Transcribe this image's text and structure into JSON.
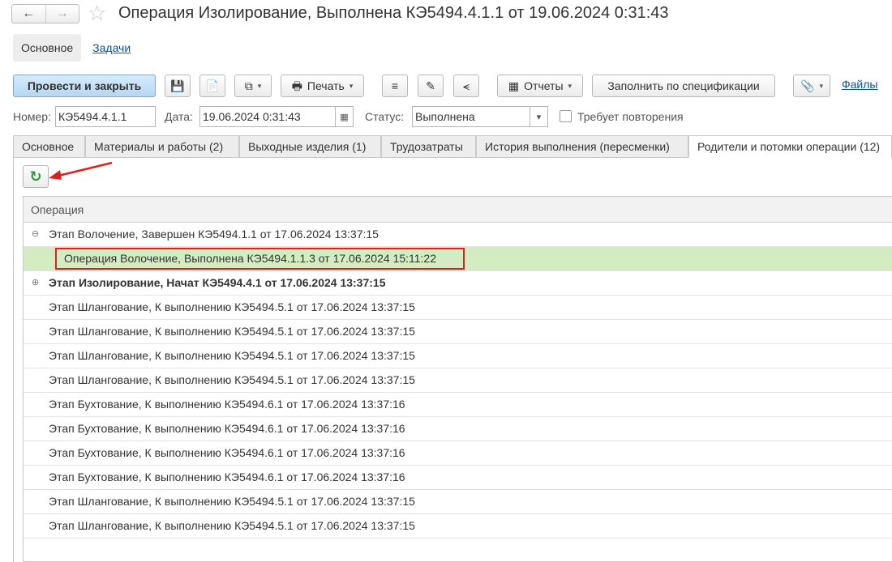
{
  "window": {
    "title": "Операция Изолирование, Выполнена КЭ5494.4.1.1 от 19.06.2024 0:31:43",
    "back_icon": "←",
    "forward_icon": "→",
    "star_icon": "☆"
  },
  "form_tabs": [
    {
      "label": "Основное",
      "active": true
    },
    {
      "label": "Задачи",
      "active": false
    }
  ],
  "toolbar": {
    "post_close_label": "Провести и закрыть",
    "print_label": "Печать",
    "reports_label": "Отчеты",
    "fill_spec_label": "Заполнить по спецификации",
    "files_label": "Файлы",
    "icons": {
      "save": "💾",
      "post": "📄",
      "create_based": "⧉",
      "print": "🖶",
      "list": "≡",
      "edit": "✎",
      "share": "⪪",
      "reports": "▦",
      "attach": "📎",
      "dropdown": "▾"
    }
  },
  "fields": {
    "number_label": "Номер:",
    "number_value": "КЭ5494.4.1.1",
    "date_label": "Дата:",
    "date_value": "19.06.2024  0:31:43",
    "status_label": "Статус:",
    "status_value": "Выполнена",
    "repeat_label": "Требует повторения",
    "repeat_checked": false,
    "calendar_icon": "▦",
    "dropdown_icon": "▾"
  },
  "panel_tabs": [
    {
      "label": "Основное",
      "active": false
    },
    {
      "label": "Материалы и работы (2)",
      "active": false
    },
    {
      "label": "Выходные изделия (1)",
      "active": false
    },
    {
      "label": "Трудозатраты",
      "active": false
    },
    {
      "label": "История выполнения (пересменки)",
      "active": false
    },
    {
      "label": "Родители и потомки операции (12)",
      "active": true
    }
  ],
  "refresh_icon": "↻",
  "grid": {
    "column_header": "Операция",
    "collapse_icon": "⊖",
    "expand_icon": "⊕",
    "rows": [
      "Этап Волочение, Завершен КЭ5494.1.1 от 17.06.2024 13:37:15",
      "Операция Волочение, Выполнена КЭ5494.1.1.3 от 17.06.2024 15:11:22",
      "Этап Изолирование, Начат КЭ5494.4.1 от 17.06.2024 13:37:15",
      "Этап Шлангование, К выполнению КЭ5494.5.1 от 17.06.2024 13:37:15",
      "Этап Шлангование, К выполнению КЭ5494.5.1 от 17.06.2024 13:37:15",
      "Этап Шлангование, К выполнению КЭ5494.5.1 от 17.06.2024 13:37:15",
      "Этап Шлангование, К выполнению КЭ5494.5.1 от 17.06.2024 13:37:15",
      "Этап Бухтование, К выполнению КЭ5494.6.1 от 17.06.2024 13:37:16",
      "Этап Бухтование, К выполнению КЭ5494.6.1 от 17.06.2024 13:37:16",
      "Этап Бухтование, К выполнению КЭ5494.6.1 от 17.06.2024 13:37:16",
      "Этап Бухтование, К выполнению КЭ5494.6.1 от 17.06.2024 13:37:16",
      "Этап Шлангование, К выполнению КЭ5494.5.1 от 17.06.2024 13:37:15",
      "Этап Шлангование, К выполнению КЭ5494.5.1 от 17.06.2024 13:37:15"
    ]
  },
  "colors": {
    "primary_button": "#b6d7f3",
    "selected_row": "#d4ecc1",
    "highlight_frame": "#e0201a",
    "annotation_arrow": "#e0201a",
    "link": "#0b4fa0"
  }
}
